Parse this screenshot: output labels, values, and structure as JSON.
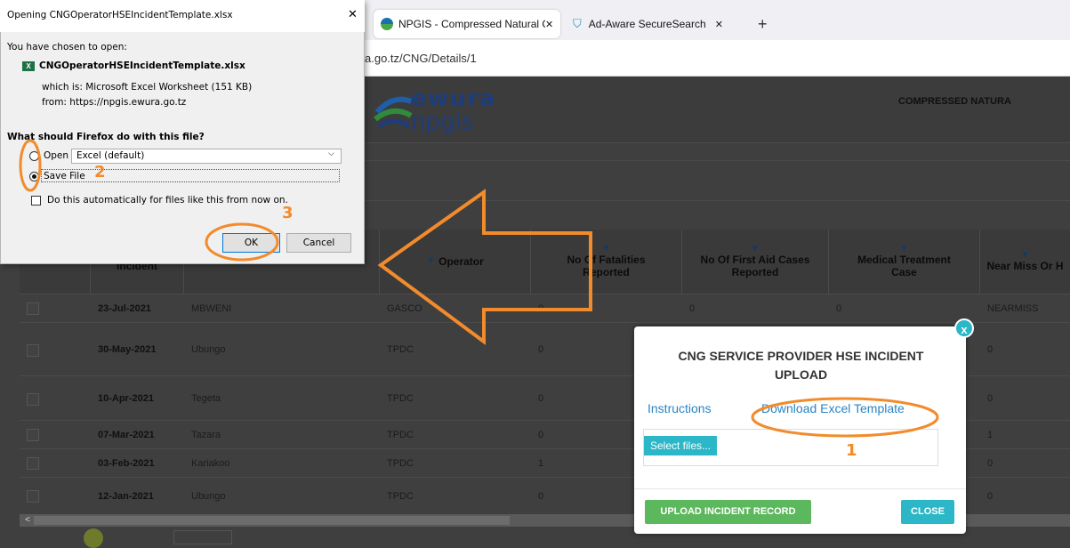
{
  "browser": {
    "tabs": [
      {
        "title": "NPGIS - Compressed Natural Ga",
        "active": true
      },
      {
        "title": "Ad-Aware SecureSearch",
        "active": false
      }
    ],
    "url_visible": "a.go.tz/CNG/Details/1"
  },
  "page": {
    "brand_top": "ewura",
    "brand_bottom": "npgis",
    "heading": "COMPRESSED NATURA"
  },
  "grid": {
    "columns": [
      "Incident",
      "Operator",
      "No Of Fatalities Reported",
      "No Of First Aid Cases Reported",
      "Medical Treatment Case",
      "Near Miss Or H"
    ],
    "rows": [
      {
        "date": "23-Jul-2021",
        "location": "MBWENI",
        "operator": "GASCO",
        "fatalities": "0",
        "first_aid": "0",
        "medical": "0",
        "near_miss": "NEARMISS"
      },
      {
        "date": "30-May-2021",
        "location": "Ubungo",
        "operator": "TPDC",
        "fatalities": "0",
        "first_aid": "",
        "medical": "",
        "near_miss": "0"
      },
      {
        "date": "10-Apr-2021",
        "location": "Tegeta",
        "operator": "TPDC",
        "fatalities": "0",
        "first_aid": "",
        "medical": "",
        "near_miss": "0"
      },
      {
        "date": "07-Mar-2021",
        "location": "Tazara",
        "operator": "TPDC",
        "fatalities": "0",
        "first_aid": "",
        "medical": "",
        "near_miss": "1"
      },
      {
        "date": "03-Feb-2021",
        "location": "Kariakoo",
        "operator": "TPDC",
        "fatalities": "1",
        "first_aid": "",
        "medical": "",
        "near_miss": "0"
      },
      {
        "date": "12-Jan-2021",
        "location": "Ubungo",
        "operator": "TPDC",
        "fatalities": "0",
        "first_aid": "",
        "medical": "",
        "near_miss": "0"
      }
    ]
  },
  "modal": {
    "title": "CNG SERVICE PROVIDER HSE INCIDENT UPLOAD",
    "close_x": "x",
    "instructions_link": "Instructions",
    "template_link": "Download Excel Template",
    "select_files": "Select files...",
    "upload_button": "UPLOAD INCIDENT RECORD",
    "close_button": "CLOSE"
  },
  "dialog": {
    "title": "Opening CNGOperatorHSEIncidentTemplate.xlsx",
    "close": "✕",
    "intro": "You have chosen to open:",
    "file_name": "CNGOperatorHSEIncidentTemplate.xlsx",
    "which_is": "which is:  Microsoft Excel Worksheet (151 KB)",
    "from": "from:  https://npgis.ewura.go.tz",
    "question": "What should Firefox do with this file?",
    "open_with_label": "Open with",
    "open_with_value": "Excel (default)",
    "save_file_label": "Save File",
    "auto_label": "Do this automatically for files like this from now on.",
    "ok": "OK",
    "cancel": "Cancel"
  },
  "annotations": {
    "step1": "1",
    "step2": "2",
    "step3": "3",
    "annotation_color": "#f28b2b"
  }
}
